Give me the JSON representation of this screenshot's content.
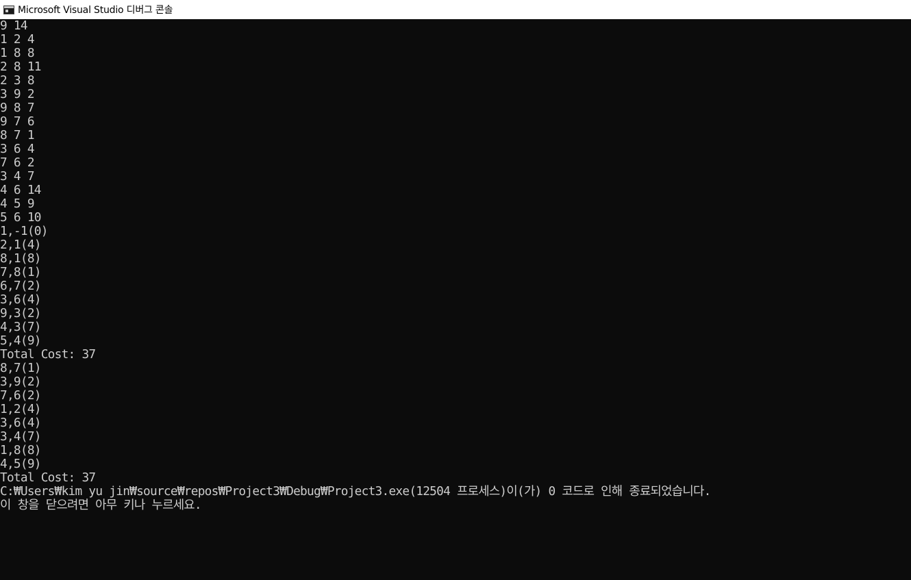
{
  "window": {
    "title": "Microsoft Visual Studio 디버그 콘솔",
    "icon": "console-app-icon"
  },
  "colors": {
    "background": "#0c0c0c",
    "text": "#cccccc",
    "titlebar": "#ffffff"
  },
  "console": {
    "lines": [
      "9 14",
      "1 2 4",
      "1 8 8",
      "2 8 11",
      "2 3 8",
      "3 9 2",
      "9 8 7",
      "9 7 6",
      "8 7 1",
      "3 6 4",
      "7 6 2",
      "3 4 7",
      "4 6 14",
      "4 5 9",
      "5 6 10",
      "1,-1(0)",
      "2,1(4)",
      "8,1(8)",
      "7,8(1)",
      "6,7(2)",
      "3,6(4)",
      "9,3(2)",
      "4,3(7)",
      "5,4(9)",
      "Total Cost: 37",
      "8,7(1)",
      "3,9(2)",
      "7,6(2)",
      "1,2(4)",
      "3,6(4)",
      "3,4(7)",
      "1,8(8)",
      "4,5(9)",
      "Total Cost: 37",
      "C:₩Users₩kim yu jin₩source₩repos₩Project3₩Debug₩Project3.exe(12504 프로세스)이(가) 0 코드로 인해 종료되었습니다.",
      "이 창을 닫으려면 아무 키나 누르세요."
    ]
  }
}
